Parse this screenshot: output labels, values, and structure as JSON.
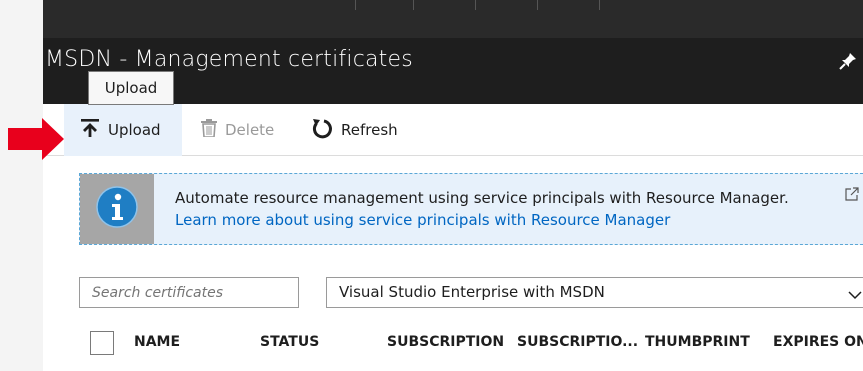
{
  "blade": {
    "title": "MSDN - Management certificates"
  },
  "toolbar": {
    "upload_label": "Upload",
    "delete_label": "Delete",
    "refresh_label": "Refresh"
  },
  "tooltip": {
    "text": "Upload"
  },
  "info": {
    "message": "Automate resource management using service principals with Resource Manager.",
    "link": "Learn more about using service principals with Resource Manager"
  },
  "filters": {
    "search_placeholder": "Search certificates",
    "subscription_selected": "Visual Studio Enterprise with MSDN"
  },
  "table": {
    "columns": [
      "NAME",
      "STATUS",
      "SUBSCRIPTION",
      "SUBSCRIPTIO...",
      "THUMBPRINT",
      "EXPIRES ON"
    ]
  },
  "colors": {
    "header_bg": "#1e1e1e",
    "accent_link": "#0066c2",
    "arrow": "#e8001c",
    "upload_hover": "#e8f1fb"
  },
  "icons": [
    "upload-icon",
    "trash-icon",
    "refresh-icon",
    "info-icon",
    "external-link-icon",
    "pin-icon",
    "chevron-down-icon"
  ]
}
